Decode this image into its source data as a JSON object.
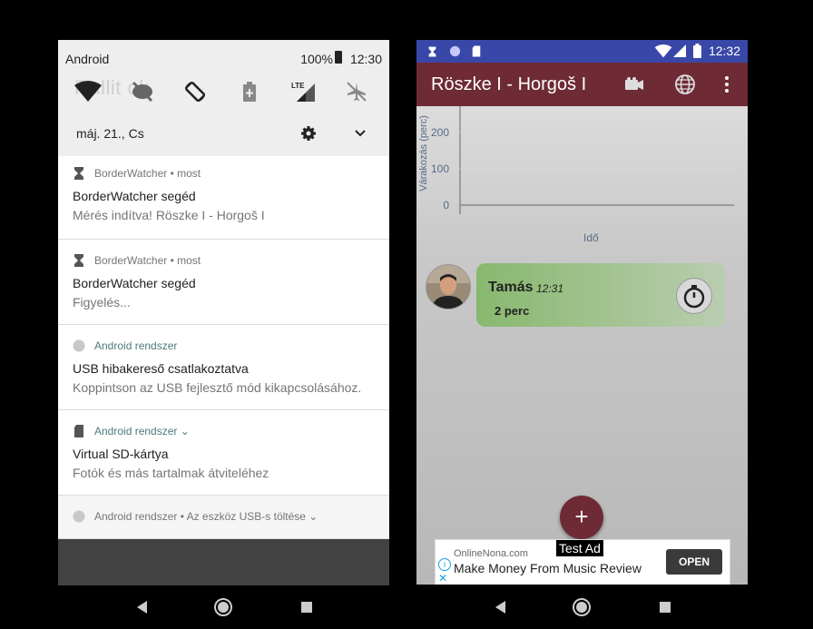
{
  "left": {
    "status": {
      "carrier": "Android",
      "battery": "100%",
      "time": "12:30"
    },
    "qs_ghost_text": "Rallit ok",
    "date": "máj. 21., Cs",
    "notifications": [
      {
        "app": "BorderWatcher",
        "when": "• most",
        "title": "BorderWatcher segéd",
        "body": "Mérés indítva! Röszke I - Horgoš I"
      },
      {
        "app": "BorderWatcher",
        "when": "• most",
        "title": "BorderWatcher segéd",
        "body": "Figyelés..."
      },
      {
        "app": "Android rendszer",
        "when": "",
        "title": "USB hibakereső csatlakoztatva",
        "body": "Koppintson az USB fejlesztő mód kikapcsolásához."
      },
      {
        "app": "Android rendszer",
        "when": "⌄",
        "title": "Virtual SD-kártya",
        "body": "Fotók és más tartalmak átviteléhez"
      }
    ],
    "summary": "Android rendszer • Az eszköz USB-s töltése ⌄"
  },
  "right": {
    "status": {
      "time": "12:32"
    },
    "appbar": {
      "title": "Röszke I - Horgoš I"
    },
    "chart_data": {
      "type": "line",
      "ylabel": "Várakozás (perc)",
      "xlabel": "Idő",
      "y_ticks": [
        "0",
        "100",
        "200"
      ],
      "ylim": [
        0,
        200
      ],
      "series": []
    },
    "message": {
      "name": "Tamás",
      "time": "12:31",
      "duration": "2 perc"
    },
    "fab": "+",
    "test_ad": "Test Ad",
    "ad": {
      "source": "OnlineNona.com",
      "headline": "Make Money From Music Review",
      "button": "OPEN"
    }
  },
  "colors": {
    "appbar": "#6e2b35",
    "status": "#3947a8",
    "bubble": "#88b86e"
  }
}
